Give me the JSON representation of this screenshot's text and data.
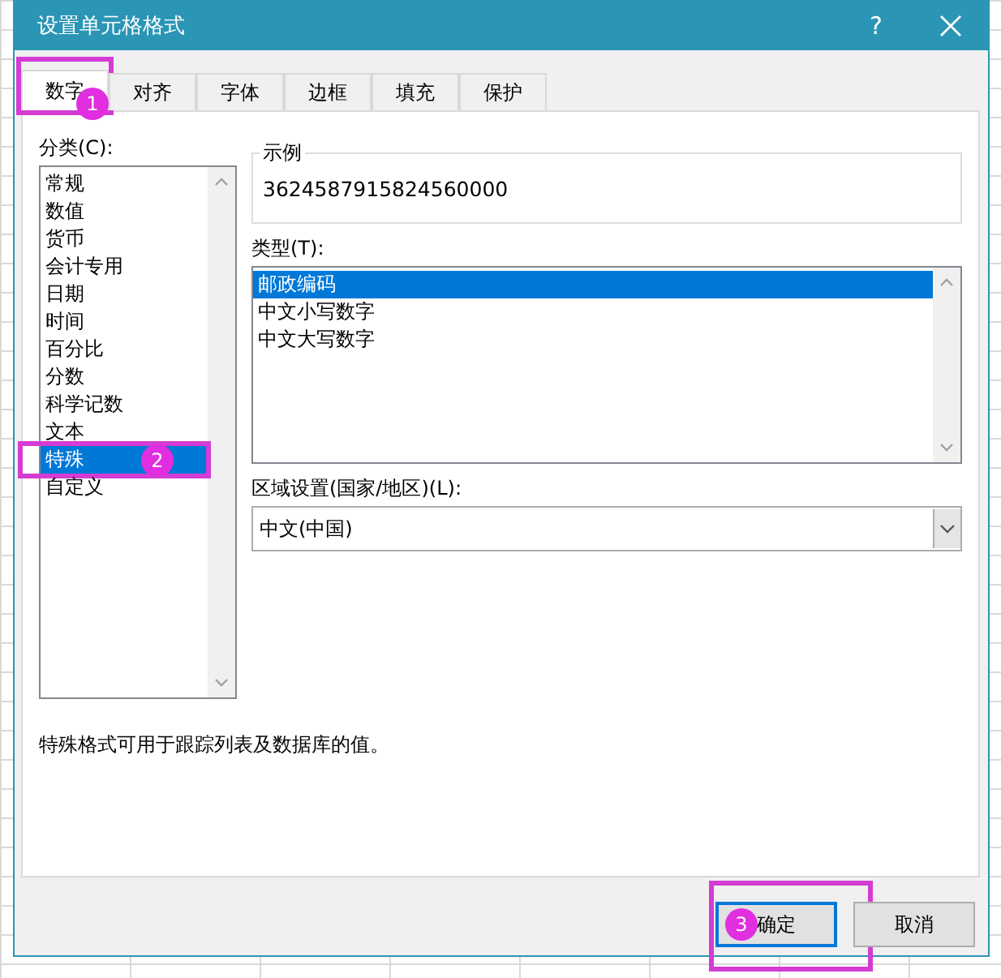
{
  "window": {
    "title": "设置单元格格式",
    "help": "?"
  },
  "tabs": [
    {
      "label": "数字",
      "selected": true,
      "annotation": "1"
    },
    {
      "label": "对齐",
      "selected": false
    },
    {
      "label": "字体",
      "selected": false
    },
    {
      "label": "边框",
      "selected": false
    },
    {
      "label": "填充",
      "selected": false
    },
    {
      "label": "保护",
      "selected": false
    }
  ],
  "category": {
    "label": "分类(C):",
    "items": [
      {
        "label": "常规",
        "selected": false
      },
      {
        "label": "数值",
        "selected": false
      },
      {
        "label": "货币",
        "selected": false
      },
      {
        "label": "会计专用",
        "selected": false
      },
      {
        "label": "日期",
        "selected": false
      },
      {
        "label": "时间",
        "selected": false
      },
      {
        "label": "百分比",
        "selected": false
      },
      {
        "label": "分数",
        "selected": false
      },
      {
        "label": "科学记数",
        "selected": false
      },
      {
        "label": "文本",
        "selected": false
      },
      {
        "label": "特殊",
        "selected": true,
        "annotation": "2"
      },
      {
        "label": "自定义",
        "selected": false
      }
    ]
  },
  "sample": {
    "label": "示例",
    "value": "3624587915824560000"
  },
  "type": {
    "label": "类型(T):",
    "items": [
      {
        "label": "邮政编码",
        "selected": true
      },
      {
        "label": "中文小写数字",
        "selected": false
      },
      {
        "label": "中文大写数字",
        "selected": false
      }
    ]
  },
  "locale": {
    "label": "区域设置(国家/地区)(L):",
    "value": "中文(中国)"
  },
  "description": "特殊格式可用于跟踪列表及数据库的值。",
  "buttons": [
    {
      "label": "确定",
      "default": true,
      "annotation": "3"
    },
    {
      "label": "取消",
      "default": false
    }
  ]
}
